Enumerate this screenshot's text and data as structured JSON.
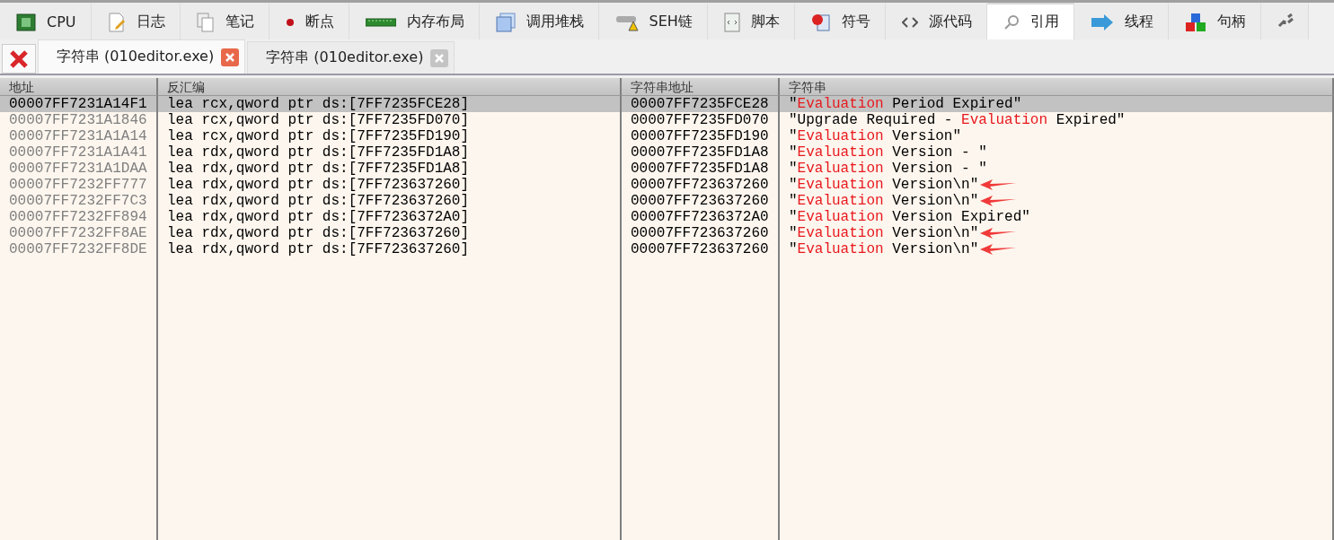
{
  "tabs": [
    {
      "label": "CPU",
      "kind": "cpu",
      "selected": false
    },
    {
      "label": "日志",
      "kind": "log",
      "selected": false
    },
    {
      "label": "笔记",
      "kind": "notes",
      "selected": false
    },
    {
      "label": "断点",
      "kind": "breakpoint",
      "selected": false
    },
    {
      "label": "内存布局",
      "kind": "memory",
      "selected": false
    },
    {
      "label": "调用堆栈",
      "kind": "stack",
      "selected": false
    },
    {
      "label": "SEH链",
      "kind": "seh",
      "selected": false
    },
    {
      "label": "脚本",
      "kind": "script",
      "selected": false
    },
    {
      "label": "符号",
      "kind": "symbol",
      "selected": false
    },
    {
      "label": "源代码",
      "kind": "source",
      "selected": false
    },
    {
      "label": "引用",
      "kind": "search",
      "selected": true
    },
    {
      "label": "线程",
      "kind": "thread",
      "selected": false
    },
    {
      "label": "句柄",
      "kind": "handle",
      "selected": false
    },
    {
      "kind": "arrows",
      "selected": false
    }
  ],
  "document_tabs": [
    {
      "label": "字符串 (010editor.exe)",
      "selected": true
    },
    {
      "label": "字符串 (010editor.exe)",
      "selected": false
    }
  ],
  "table": {
    "columns": [
      "地址",
      "反汇编",
      "字符串地址",
      "字符串"
    ],
    "rows": [
      {
        "address": "00007FF7231A14F1",
        "disassembly": "lea rcx,qword ptr ds:[7FF7235FCE28]",
        "string_address": "00007FF7235FCE28",
        "string": [
          {
            "text": "\"",
            "highlight": false
          },
          {
            "text": "Evaluation",
            "highlight": true
          },
          {
            "text": " Period Expired\"",
            "highlight": false
          }
        ],
        "selected": true
      },
      {
        "address": "00007FF7231A1846",
        "disassembly": "lea rcx,qword ptr ds:[7FF7235FD070]",
        "string_address": "00007FF7235FD070",
        "string": [
          {
            "text": "\"Upgrade Required - ",
            "highlight": false
          },
          {
            "text": "Evaluation",
            "highlight": true
          },
          {
            "text": " Expired\"",
            "highlight": false
          }
        ],
        "selected": false
      },
      {
        "address": "00007FF7231A1A14",
        "disassembly": "lea rcx,qword ptr ds:[7FF7235FD190]",
        "string_address": "00007FF7235FD190",
        "string": [
          {
            "text": "\"",
            "highlight": false
          },
          {
            "text": "Evaluation",
            "highlight": true
          },
          {
            "text": " Version\"",
            "highlight": false
          }
        ],
        "selected": false
      },
      {
        "address": "00007FF7231A1A41",
        "disassembly": "lea rdx,qword ptr ds:[7FF7235FD1A8]",
        "string_address": "00007FF7235FD1A8",
        "string": [
          {
            "text": "\"",
            "highlight": false
          },
          {
            "text": "Evaluation",
            "highlight": true
          },
          {
            "text": " Version - \"",
            "highlight": false
          }
        ],
        "selected": false
      },
      {
        "address": "00007FF7231A1DAA",
        "disassembly": "lea rdx,qword ptr ds:[7FF7235FD1A8]",
        "string_address": "00007FF7235FD1A8",
        "string": [
          {
            "text": "\"",
            "highlight": false
          },
          {
            "text": "Evaluation",
            "highlight": true
          },
          {
            "text": " Version - \"",
            "highlight": false
          }
        ],
        "selected": false
      },
      {
        "address": "00007FF7232FF777",
        "disassembly": "lea rdx,qword ptr ds:[7FF723637260]",
        "string_address": "00007FF723637260",
        "string": [
          {
            "text": "\"",
            "highlight": false
          },
          {
            "text": "Evaluation",
            "highlight": true
          },
          {
            "text": " Version\\n\"",
            "highlight": false
          }
        ],
        "selected": false,
        "arrow": true
      },
      {
        "address": "00007FF7232FF7C3",
        "disassembly": "lea rdx,qword ptr ds:[7FF723637260]",
        "string_address": "00007FF723637260",
        "string": [
          {
            "text": "\"",
            "highlight": false
          },
          {
            "text": "Evaluation",
            "highlight": true
          },
          {
            "text": " Version\\n\"",
            "highlight": false
          }
        ],
        "selected": false,
        "arrow": true
      },
      {
        "address": "00007FF7232FF894",
        "disassembly": "lea rdx,qword ptr ds:[7FF7236372A0]",
        "string_address": "00007FF7236372A0",
        "string": [
          {
            "text": "\"",
            "highlight": false
          },
          {
            "text": "Evaluation",
            "highlight": true
          },
          {
            "text": " Version Expired\"",
            "highlight": false
          }
        ],
        "selected": false
      },
      {
        "address": "00007FF7232FF8AE",
        "disassembly": "lea rdx,qword ptr ds:[7FF723637260]",
        "string_address": "00007FF723637260",
        "string": [
          {
            "text": "\"",
            "highlight": false
          },
          {
            "text": "Evaluation",
            "highlight": true
          },
          {
            "text": " Version\\n\"",
            "highlight": false
          }
        ],
        "selected": false,
        "arrow": true
      },
      {
        "address": "00007FF7232FF8DE",
        "disassembly": "lea rdx,qword ptr ds:[7FF723637260]",
        "string_address": "00007FF723637260",
        "string": [
          {
            "text": "\"",
            "highlight": false
          },
          {
            "text": "Evaluation",
            "highlight": true
          },
          {
            "text": " Version\\n\"",
            "highlight": false
          }
        ],
        "selected": false,
        "arrow": true
      }
    ]
  }
}
